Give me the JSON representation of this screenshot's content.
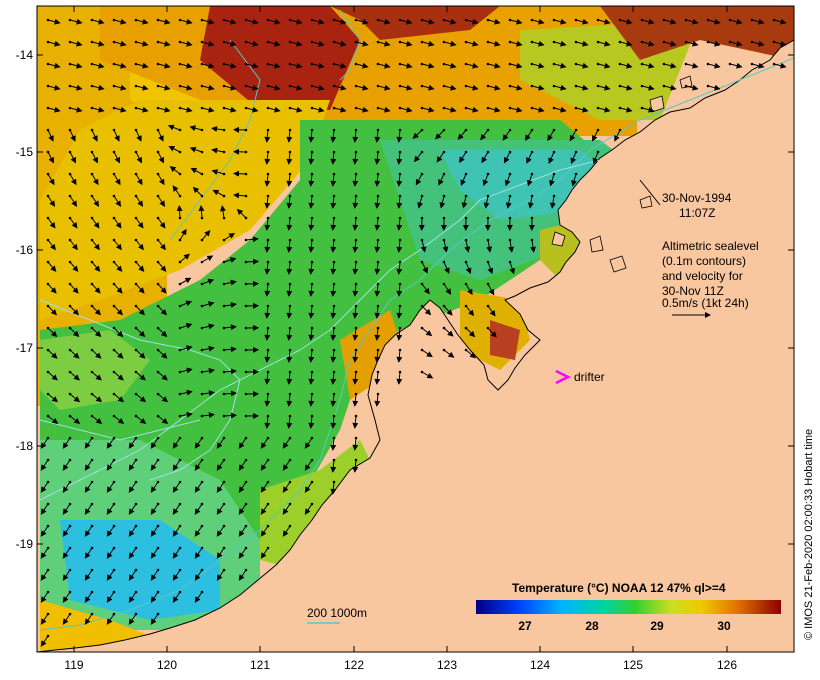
{
  "map": {
    "lat_ticks": [
      "-14",
      "-15",
      "-16",
      "-17",
      "-18",
      "-19"
    ],
    "lon_ticks": [
      "119",
      "120",
      "121",
      "122",
      "123",
      "124",
      "125",
      "126"
    ]
  },
  "annotations": {
    "date": "30-Nov-1994",
    "time": "11:07Z",
    "legend_lines": [
      "Altimetric sealevel",
      "(0.1m contours)",
      "and velocity for",
      "30-Nov 11Z",
      "0.5m/s (1kt 24h)"
    ],
    "drifter_label": "drifter",
    "isobath_label": "200  1000m"
  },
  "colorbar": {
    "title": "Temperature (°C) NOAA 12 47% ql>=4",
    "ticks": [
      "27",
      "28",
      "29",
      "30"
    ]
  },
  "credit": "© IMOS 21-Feb-2020 02:00:33 Hobart time",
  "colors": {
    "land": "#f8c7a0",
    "isobath_200": "#58c8c8",
    "isobath_1000": "#9fe0e0",
    "drifter": "#ff00ff"
  }
}
